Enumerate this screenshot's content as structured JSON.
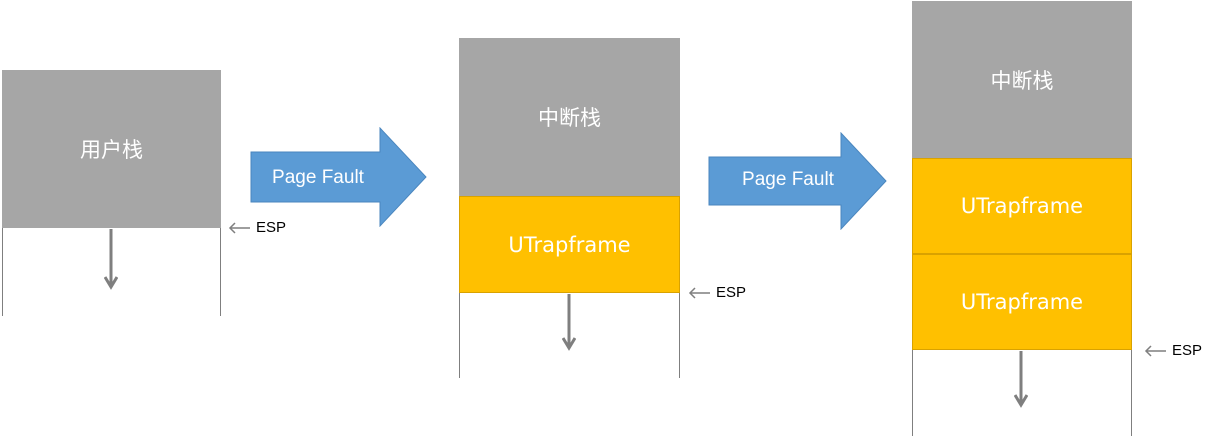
{
  "stack1": {
    "label": "用户栈",
    "esp": "ESP"
  },
  "transition1": {
    "label": "Page Fault"
  },
  "stack2": {
    "top_label": "中断栈",
    "frame_label": "UTrapframe",
    "esp": "ESP"
  },
  "transition2": {
    "label": "Page Fault"
  },
  "stack3": {
    "top_label": "中断栈",
    "frame1_label": "UTrapframe",
    "frame2_label": "UTrapframe",
    "esp": "ESP"
  },
  "colors": {
    "stack_gray": "#a6a6a6",
    "frame_gold": "#ffc000",
    "arrow_blue": "#5b9bd5"
  }
}
